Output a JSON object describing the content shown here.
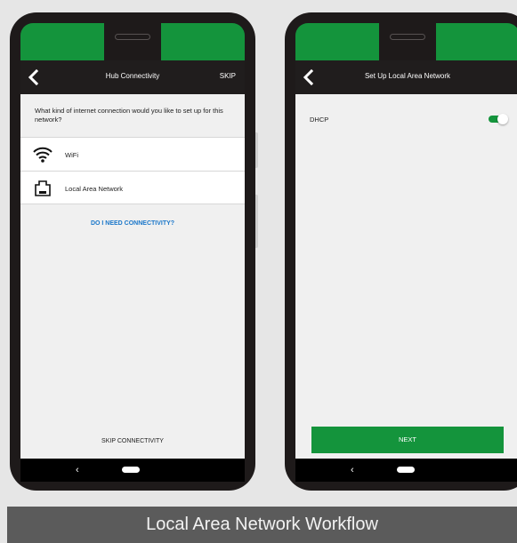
{
  "colors": {
    "brand_green": "#14943c",
    "appbar": "#201d1d",
    "link_blue": "#1976c9",
    "caption_bg": "#5b5b5b"
  },
  "left_screen": {
    "title": "Hub Connectivity",
    "skip_label": "SKIP",
    "prompt": "What kind of internet connection would you like to set up for this network?",
    "options": [
      {
        "icon": "wifi-icon",
        "label": "WiFi"
      },
      {
        "icon": "ethernet-port-icon",
        "label": "Local Area Network"
      }
    ],
    "help_link": "DO I NEED CONNECTIVITY?",
    "skip_connectivity": "SKIP CONNECTIVITY"
  },
  "right_screen": {
    "title": "Set Up Local Area Network",
    "dhcp_label": "DHCP",
    "dhcp_enabled": true,
    "next_label": "NEXT"
  },
  "navbar": {
    "back_glyph": "‹"
  },
  "caption": "Local Area Network Workflow"
}
